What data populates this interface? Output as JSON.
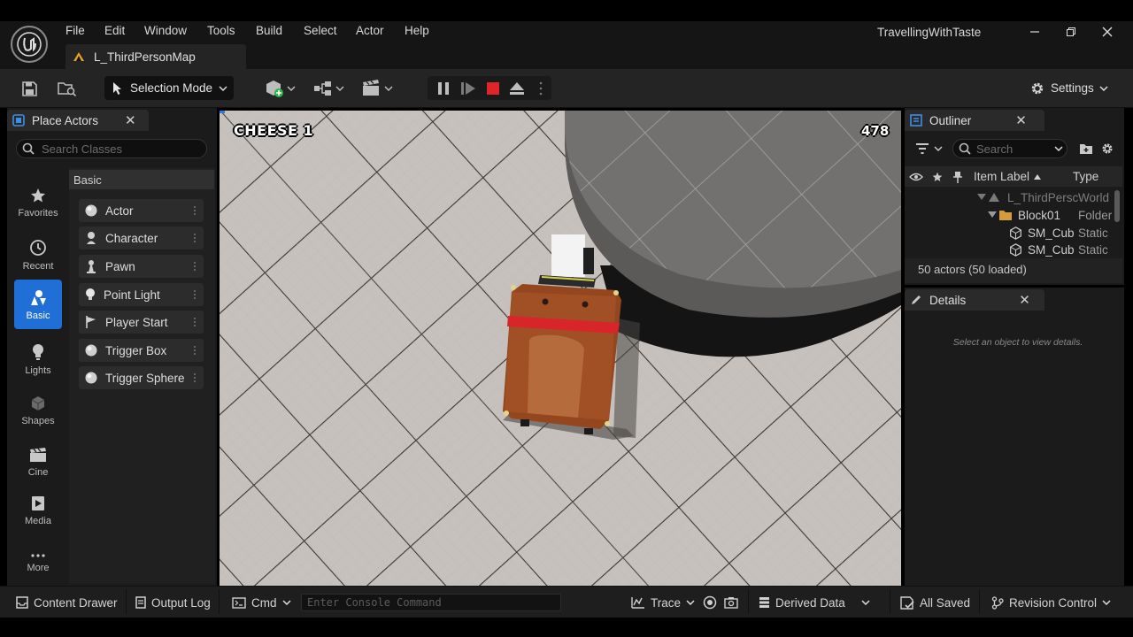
{
  "window": {
    "project_name": "TravellingWithTaste",
    "level_tab": "L_ThirdPersonMap"
  },
  "menu": [
    "File",
    "Edit",
    "Window",
    "Tools",
    "Build",
    "Select",
    "Actor",
    "Help"
  ],
  "toolbar": {
    "mode_label": "Selection Mode",
    "settings_label": "Settings"
  },
  "place_actors": {
    "tab_label": "Place Actors",
    "search_placeholder": "Search Classes",
    "section_header": "Basic",
    "categories": [
      {
        "label": "Favorites",
        "icon": "star-icon"
      },
      {
        "label": "Recent",
        "icon": "clock-icon"
      },
      {
        "label": "Basic",
        "icon": "basic-shapes-icon",
        "active": true
      },
      {
        "label": "Lights",
        "icon": "bulb-icon"
      },
      {
        "label": "Shapes",
        "icon": "cube-icon"
      },
      {
        "label": "Cine",
        "icon": "clapper-icon"
      },
      {
        "label": "Media",
        "icon": "media-icon"
      },
      {
        "label": "More",
        "icon": "ellipsis-icon"
      }
    ],
    "items": [
      {
        "label": "Actor",
        "icon": "sphere-icon"
      },
      {
        "label": "Character",
        "icon": "character-icon"
      },
      {
        "label": "Pawn",
        "icon": "pawn-icon"
      },
      {
        "label": "Point Light",
        "icon": "bulb-icon"
      },
      {
        "label": "Player Start",
        "icon": "flag-icon"
      },
      {
        "label": "Trigger Box",
        "icon": "sphere-icon"
      },
      {
        "label": "Trigger Sphere",
        "icon": "sphere-icon"
      }
    ]
  },
  "viewport": {
    "hud_cheese": "CHEESE 1",
    "hud_score": "478"
  },
  "outliner": {
    "tab_label": "Outliner",
    "search_placeholder": "Search",
    "columns": {
      "label": "Item Label",
      "type": "Type"
    },
    "rows": [
      {
        "label": "L_ThirdPersc",
        "type": "World",
        "dim": true
      },
      {
        "label": "Block01",
        "type": "Folder"
      },
      {
        "label": "SM_Cub",
        "type": "Static"
      },
      {
        "label": "SM_Cub",
        "type": "Static"
      }
    ],
    "actors_count": "50 actors (50 loaded)"
  },
  "details": {
    "tab_label": "Details",
    "hint": "Select an object to view details."
  },
  "statusbar": {
    "content_drawer": "Content Drawer",
    "output_log": "Output Log",
    "cmd": "Cmd",
    "console_placeholder": "Enter Console Command",
    "trace": "Trace",
    "derived_data": "Derived Data",
    "all_saved": "All Saved",
    "revision_control": "Revision Control"
  },
  "colors": {
    "accent_blue": "#1f6fd6",
    "stop_red": "#e0252a",
    "panel_bg": "#1b1b1b"
  }
}
